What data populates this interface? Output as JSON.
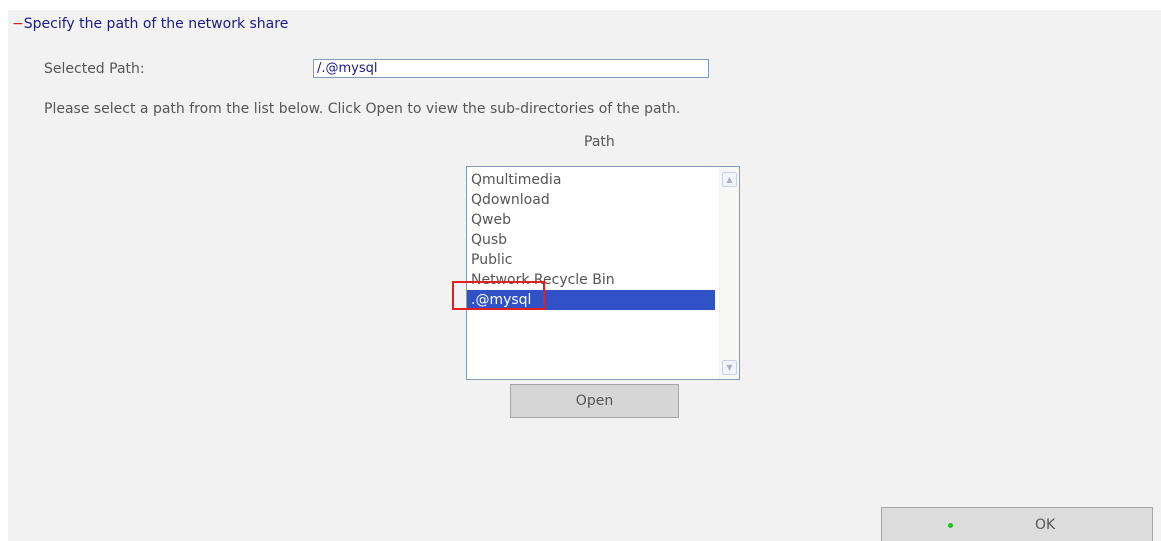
{
  "section": {
    "toggle": "−",
    "title": "Specify the path of the network share"
  },
  "selected_path": {
    "label": "Selected Path:",
    "value": "/.@mysql"
  },
  "hint": "Please select a path from the list below. Click Open to view the sub-directories of the path.",
  "path_list": {
    "header": "Path",
    "items": [
      "Qmultimedia",
      "Qdownload",
      "Qweb",
      "Qusb",
      "Public",
      "Network Recycle Bin",
      ".@mysql"
    ],
    "selected": ".@mysql",
    "scroll_up_icon": "▲",
    "scroll_down_icon": "▼"
  },
  "open_button": {
    "label": "Open"
  },
  "ok_button": {
    "label": "OK",
    "indicator_color": "#1ec21e"
  },
  "colors": {
    "selection": "#3152c7",
    "annotation": "#e02020",
    "title": "#1a1a8c"
  }
}
